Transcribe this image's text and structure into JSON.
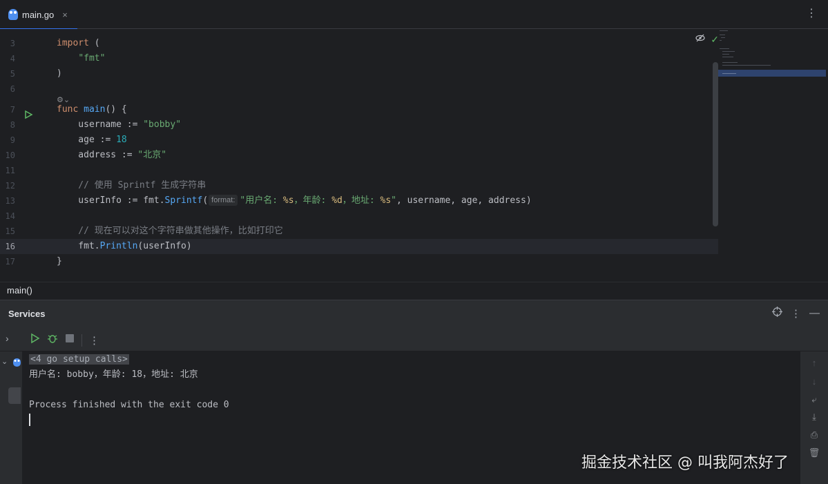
{
  "tab": {
    "label": "main.go",
    "close": "×",
    "menu": "⋮"
  },
  "editor": {
    "lines": [
      {
        "n": "3",
        "tokens": [
          [
            "kw",
            "import"
          ],
          [
            "pkg",
            " ("
          ]
        ]
      },
      {
        "n": "4",
        "tokens": [
          [
            "pkg",
            "    "
          ],
          [
            "str",
            "\"fmt\""
          ]
        ]
      },
      {
        "n": "5",
        "tokens": [
          [
            "pkg",
            ")"
          ]
        ]
      },
      {
        "n": "6",
        "tokens": []
      },
      {
        "n": "7",
        "tokens": [
          [
            "kw",
            "func"
          ],
          [
            "pkg",
            " "
          ],
          [
            "fn",
            "main"
          ],
          [
            "pkg",
            "() {"
          ]
        ]
      },
      {
        "n": "8",
        "tokens": [
          [
            "pkg",
            "    username := "
          ],
          [
            "str",
            "\"bobby\""
          ]
        ]
      },
      {
        "n": "9",
        "tokens": [
          [
            "pkg",
            "    age := "
          ],
          [
            "num",
            "18"
          ]
        ]
      },
      {
        "n": "10",
        "tokens": [
          [
            "pkg",
            "    address := "
          ],
          [
            "str",
            "\"北京\""
          ]
        ]
      },
      {
        "n": "11",
        "tokens": []
      },
      {
        "n": "12",
        "tokens": [
          [
            "cmt",
            "    // 使用 Sprintf 生成字符串"
          ]
        ]
      },
      {
        "n": "13",
        "tokens": [
          [
            "pkg",
            "    userInfo := fmt."
          ],
          [
            "fn",
            "Sprintf"
          ],
          [
            "pkg",
            "("
          ],
          [
            "hint",
            "format:"
          ],
          [
            "str",
            "\"用户名: "
          ],
          [
            "fmt",
            "%s"
          ],
          [
            "str",
            "，年龄: "
          ],
          [
            "fmt",
            "%d"
          ],
          [
            "str",
            "，地址: "
          ],
          [
            "fmt",
            "%s"
          ],
          [
            "str",
            "\""
          ],
          [
            "pkg",
            ", username, age, address)"
          ]
        ]
      },
      {
        "n": "14",
        "tokens": []
      },
      {
        "n": "15",
        "tokens": [
          [
            "cmt",
            "    // 现在可以对这个字符串做其他操作，比如打印它"
          ]
        ]
      },
      {
        "n": "16",
        "tokens": [
          [
            "pkg",
            "    fmt."
          ],
          [
            "fn",
            "Println"
          ],
          [
            "pkg",
            "(userInfo)"
          ]
        ]
      },
      {
        "n": "17",
        "tokens": [
          [
            "pkg",
            "}"
          ]
        ]
      }
    ],
    "current_line": "16"
  },
  "breadcrumb": {
    "label": "main()"
  },
  "services": {
    "title": "Services",
    "setup": "<4 go setup calls>",
    "output": "用户名: bobby，年龄: 18，地址: 北京",
    "process": "Process finished with the exit code 0"
  },
  "watermark": "掘金技术社区 @ 叫我阿杰好了",
  "colors": {
    "accent": "#3574f0",
    "run_green": "#5fb865",
    "bg": "#1e1f22",
    "panel": "#2b2d30"
  }
}
